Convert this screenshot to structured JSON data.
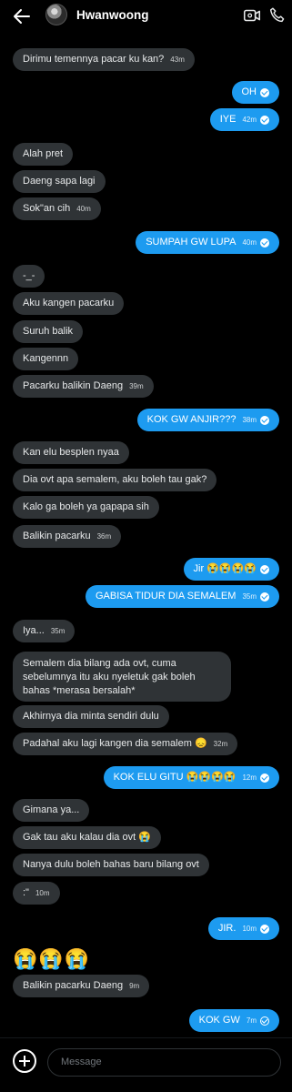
{
  "header": {
    "contact_name": "Hwanwoong"
  },
  "composer": {
    "placeholder": "Message"
  },
  "messages": [
    {
      "text": "Dirimu temennya pacar ku kan?",
      "time": "43m"
    },
    {
      "text": "OH",
      "time": ""
    },
    {
      "text": "IYE",
      "time": "42m"
    },
    {
      "text": "Alah pret",
      "time": ""
    },
    {
      "text": "Daeng sapa lagi",
      "time": ""
    },
    {
      "text": "Sok\"an cih",
      "time": "40m"
    },
    {
      "text": "SUMPAH GW LUPA",
      "time": "40m"
    },
    {
      "text": "-_-",
      "time": ""
    },
    {
      "text": "Aku kangen pacarku",
      "time": ""
    },
    {
      "text": "Suruh balik",
      "time": ""
    },
    {
      "text": "Kangennn",
      "time": ""
    },
    {
      "text": "Pacarku balikin Daeng",
      "time": "39m"
    },
    {
      "text": "KOK GW ANJIR???",
      "time": "38m"
    },
    {
      "text": "Kan elu besplen nyaa",
      "time": ""
    },
    {
      "text": "Dia ovt apa semalem, aku boleh tau gak?",
      "time": ""
    },
    {
      "text": "Kalo ga boleh ya gapapa sih",
      "time": ""
    },
    {
      "text": "Balikin pacarku",
      "time": "36m"
    },
    {
      "text": "Jir 😭😭😭😭",
      "time": ""
    },
    {
      "text": "GABISA TIDUR DIA SEMALEM",
      "time": "35m"
    },
    {
      "text": "Iya...",
      "time": "35m"
    },
    {
      "text": "Semalem dia bilang ada ovt, cuma sebelumnya itu aku nyeletuk gak boleh bahas *merasa bersalah*",
      "time": ""
    },
    {
      "text": "Akhirnya dia minta sendiri dulu",
      "time": ""
    },
    {
      "text": "Padahal aku lagi kangen dia semalem 😞",
      "time": "32m"
    },
    {
      "text": "KOK ELU GITU 😭😭😭😭",
      "time": "12m"
    },
    {
      "text": "Gimana ya...",
      "time": ""
    },
    {
      "text": "Gak tau aku kalau dia ovt 😭",
      "time": ""
    },
    {
      "text": "Nanya dulu boleh bahas baru bilang ovt",
      "time": ""
    },
    {
      "text": ":\"",
      "time": "10m"
    },
    {
      "text": "JIR.",
      "time": "10m"
    },
    {
      "text": "😭😭😭",
      "time": ""
    },
    {
      "text": "Balikin pacarku Daeng",
      "time": "9m"
    },
    {
      "text": "KOK GW",
      "time": "7m"
    }
  ]
}
